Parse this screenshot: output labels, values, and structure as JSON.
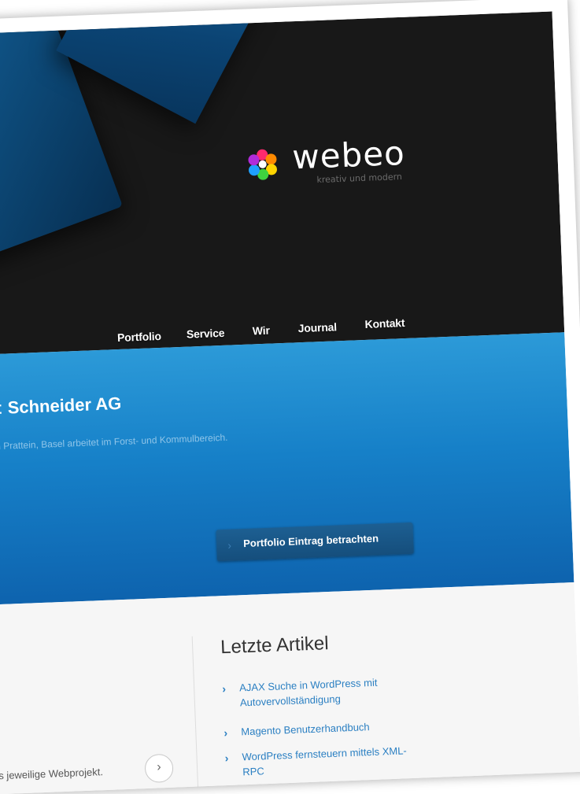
{
  "brand": {
    "name": "webeo",
    "tagline": "kreativ und modern"
  },
  "nav": {
    "items": [
      {
        "label": "Portfolio"
      },
      {
        "label": "Service"
      },
      {
        "label": "Wir"
      },
      {
        "label": "Journal"
      },
      {
        "label": "Kontakt"
      }
    ]
  },
  "featured": {
    "title_prefix": "kt: ",
    "title_name": "Schneider AG",
    "description": "z in Prattein, Basel arbeitet im Forst- und Kommulbereich.",
    "button_label": "Portfolio Eintrag betrachten"
  },
  "content": {
    "snippet": "s jeweilige Webprojekt."
  },
  "sidebar": {
    "title": "Letzte Artikel",
    "articles": [
      {
        "label": "AJAX Suche in WordPress mit Autovervollständigung"
      },
      {
        "label": "Magento Benutzerhandbuch"
      },
      {
        "label": "WordPress fernsteuern mittels XML-RPC"
      }
    ]
  },
  "colors": {
    "hero_bg": "#181818",
    "accent_blue": "#1680c8",
    "link_blue": "#2a7fc2"
  },
  "icons": {
    "logo": "flower-logo-icon",
    "chevron": "chevron-right-icon"
  }
}
